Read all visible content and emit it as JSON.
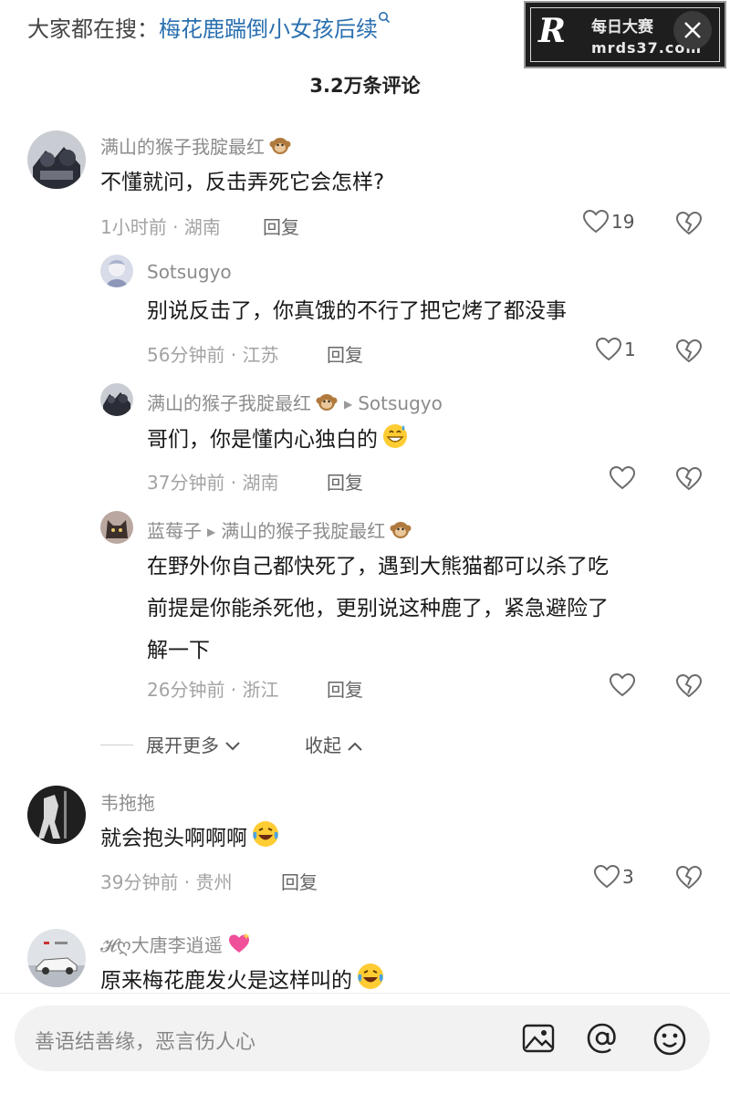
{
  "header": {
    "search_prefix": "大家都在搜：",
    "search_keyword": "梅花鹿踹倒小女孩后续",
    "search_icon": "magnifier-icon",
    "close_icon": "close-icon"
  },
  "watermark": {
    "logo": "R",
    "title": "每日大赛",
    "url": "mrds37.com"
  },
  "comment_count": "3.2万条评论",
  "comments": [
    {
      "user": "满山的猴子我腚最红",
      "badge": "monkey-emoji",
      "text": "不懂就问，反击弄死它会怎样?",
      "time_loc": "1小时前 · 湖南",
      "reply": "回复",
      "likes": "19",
      "replies": [
        {
          "user": "Sotsugyo",
          "text": "别说反击了，你真饿的不行了把它烤了都没事",
          "time_loc": "56分钟前 · 江苏",
          "reply": "回复",
          "likes": "1"
        },
        {
          "user": "满山的猴子我腚最红",
          "reply_to": "Sotsugyo",
          "text": "哥们，你是懂内心独白的",
          "time_loc": "37分钟前 · 湖南",
          "reply": "回复",
          "likes": ""
        },
        {
          "user": "蓝莓子",
          "reply_to": "满山的猴子我腚最红",
          "text_lines": [
            "在野外你自己都快死了，遇到大熊猫都可以杀了吃",
            "前提是你能杀死他，更别说这种鹿了，紧急避险了",
            "解一下"
          ],
          "time_loc": "26分钟前 · 浙江",
          "reply": "回复",
          "likes": ""
        }
      ],
      "expand_more": "展开更多",
      "collapse": "收起"
    },
    {
      "user": "韦拖拖",
      "text": "就会抱头啊啊啊",
      "time_loc": "39分钟前 · 贵州",
      "reply": "回复",
      "likes": "3"
    },
    {
      "user_prefix": "𝓗ღ",
      "user": "大唐李逍遥",
      "text": "原来梅花鹿发火是这样叫的"
    }
  ],
  "input": {
    "placeholder": "善语结善缘，恶言伤人心",
    "image_icon": "image-icon",
    "at_icon": "at-icon",
    "emoji_icon": "emoji-icon"
  },
  "colors": {
    "link_blue": "#2a6fb0",
    "meta_gray": "#a3a3a3",
    "username_gray": "#8c8c8c"
  }
}
